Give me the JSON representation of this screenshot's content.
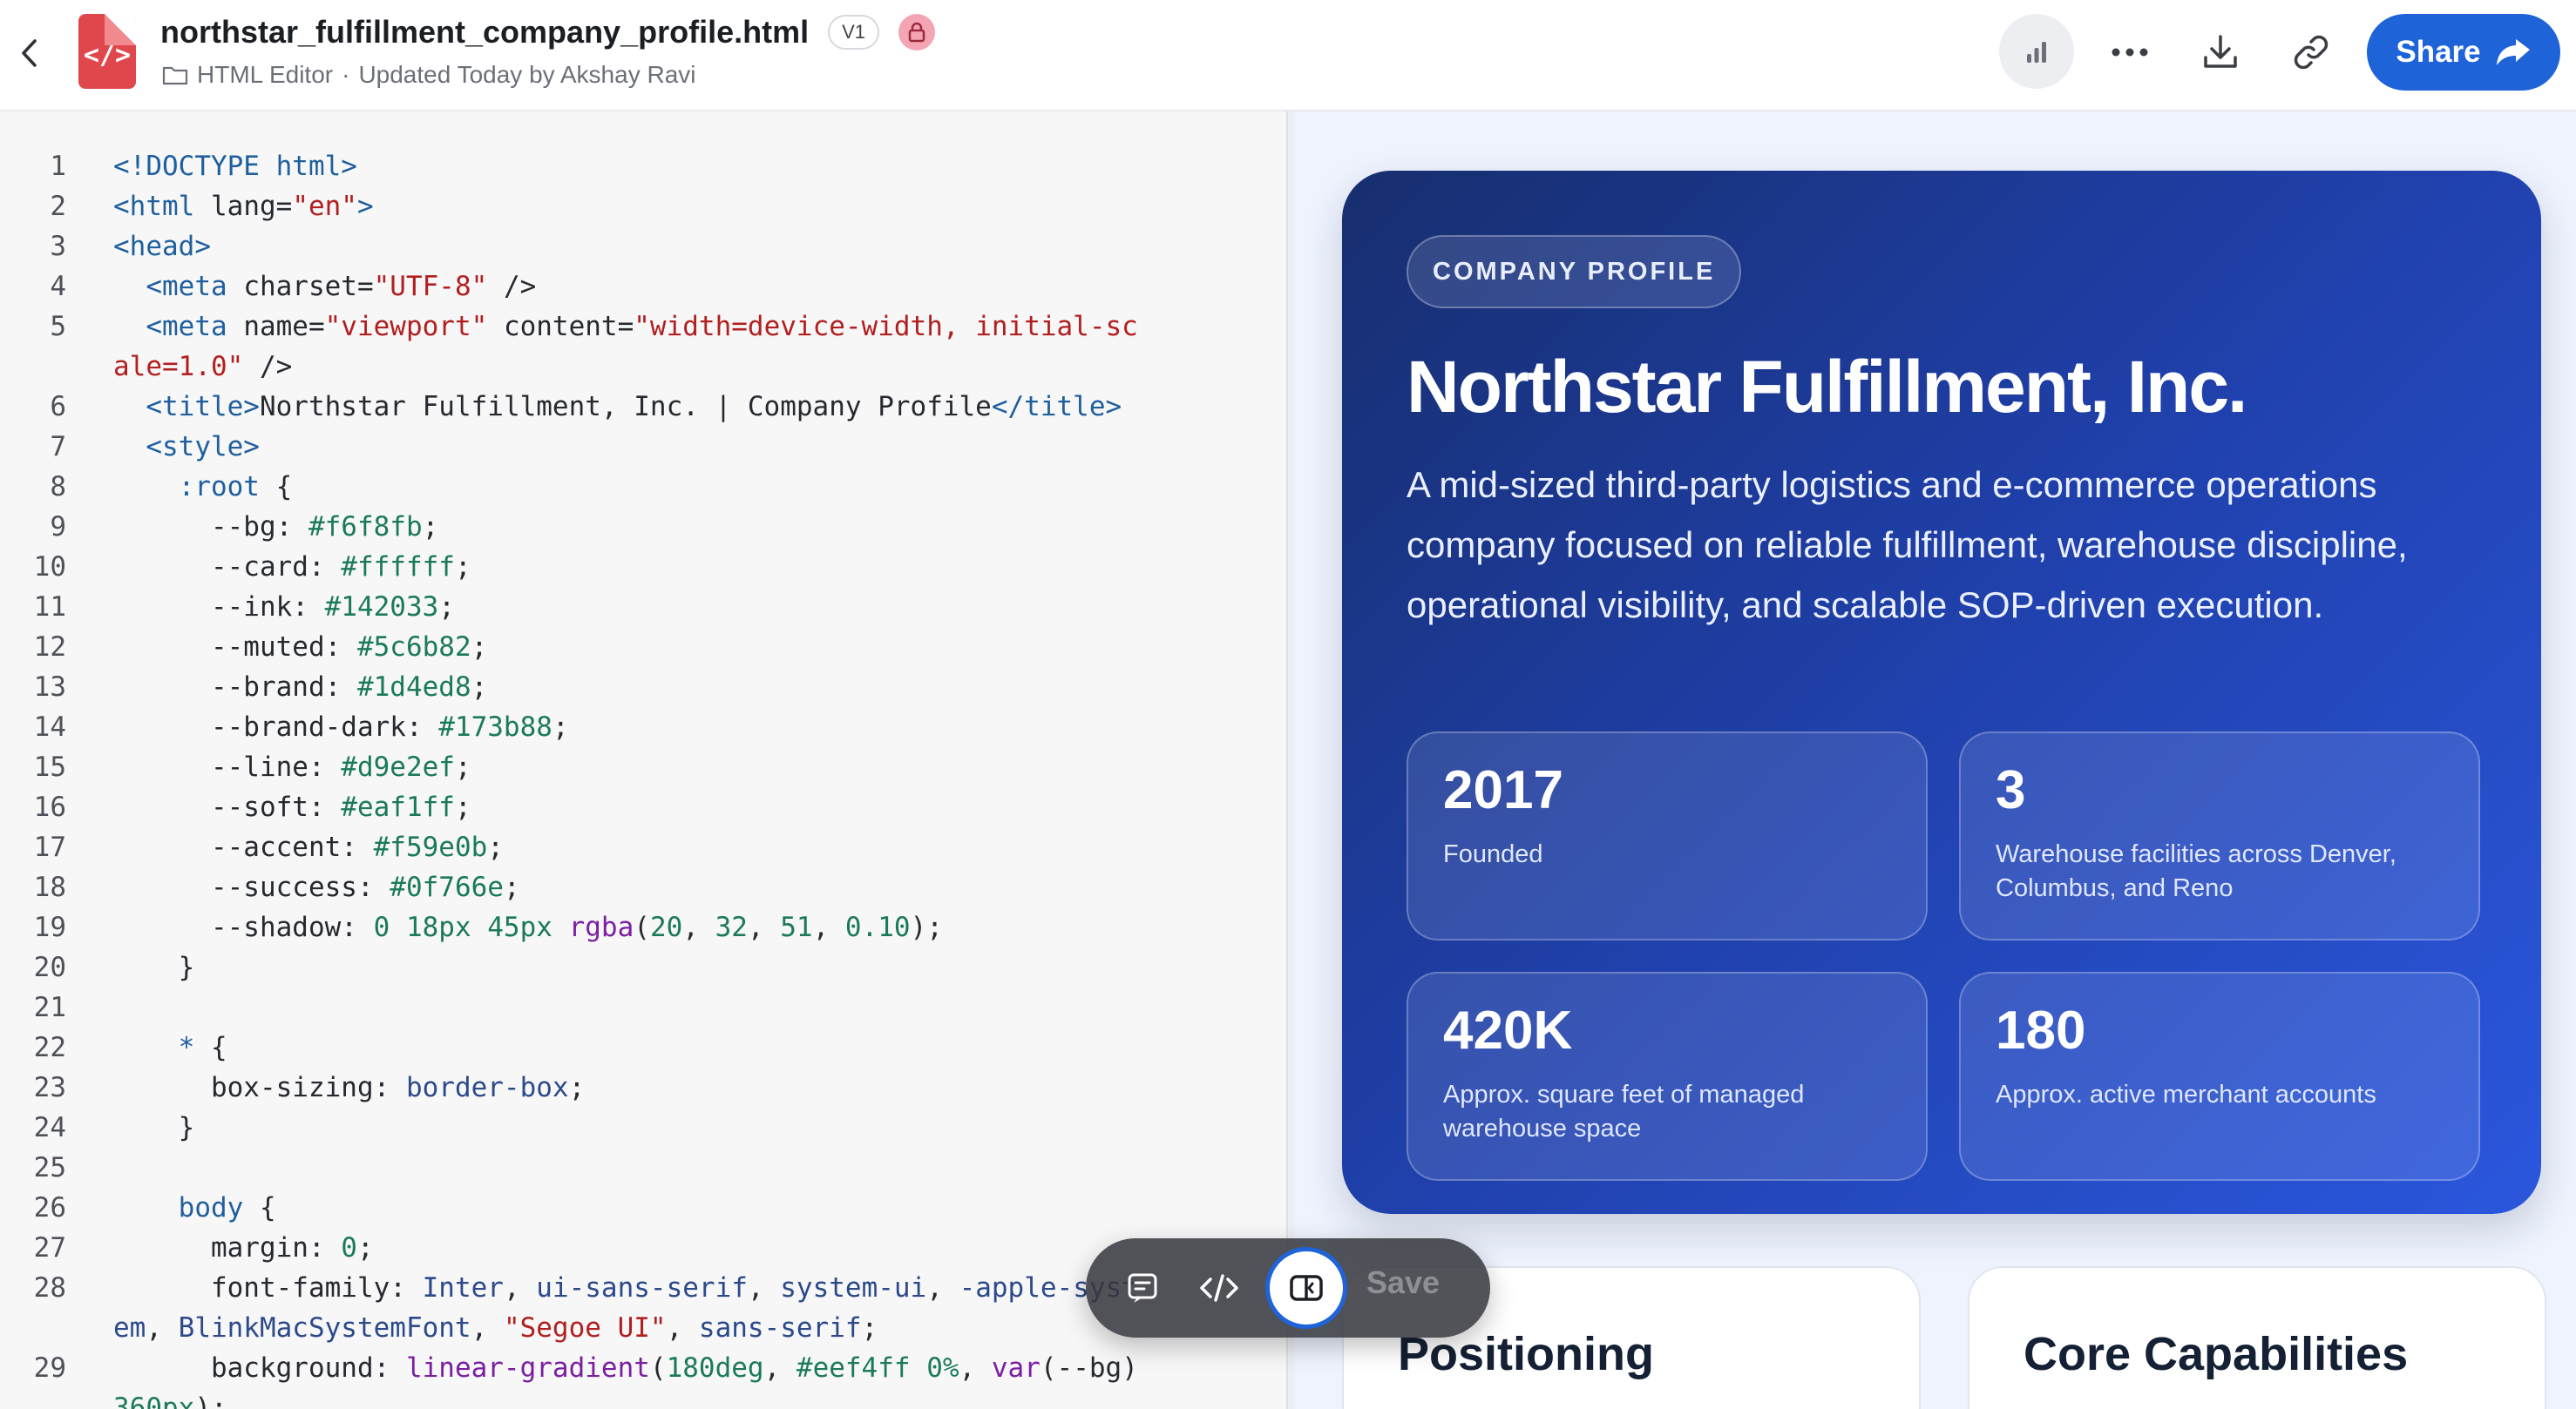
{
  "header": {
    "file_title": "northstar_fulfillment_company_profile.html",
    "version": "V1",
    "location": "HTML Editor",
    "updated": "Updated Today by Akshay Ravi",
    "share_label": "Share",
    "file_icon_glyph": "</>"
  },
  "editor": {
    "lines": [
      {
        "n": "1",
        "html": "<span class='tok-tag'>&lt;!DOCTYPE html&gt;</span>"
      },
      {
        "n": "2",
        "html": "<span class='tok-tag'>&lt;html</span> lang=<span class='tok-str'>\"en\"</span><span class='tok-tag'>&gt;</span>"
      },
      {
        "n": "3",
        "html": "<span class='tok-tag'>&lt;head&gt;</span>"
      },
      {
        "n": "4",
        "html": "  <span class='tok-tag'>&lt;meta</span> charset=<span class='tok-str'>\"UTF-8\"</span> /&gt;"
      },
      {
        "n": "5",
        "html": "  <span class='tok-tag'>&lt;meta</span> name=<span class='tok-str'>\"viewport\"</span> content=<span class='tok-str'>\"width=device-width, initial-scale=1.0\"</span> /&gt;"
      },
      {
        "n": "6",
        "html": "  <span class='tok-tag'>&lt;title&gt;</span>Northstar Fulfillment, Inc. | Company Profile<span class='tok-tag'>&lt;/title&gt;</span>"
      },
      {
        "n": "7",
        "html": "  <span class='tok-tag'>&lt;style&gt;</span>"
      },
      {
        "n": "8",
        "html": "    <span class='tok-sel'>:root</span> {"
      },
      {
        "n": "9",
        "html": "      --bg: <span class='tok-num'>#f6f8fb</span>;"
      },
      {
        "n": "10",
        "html": "      --card: <span class='tok-num'>#ffffff</span>;"
      },
      {
        "n": "11",
        "html": "      --ink: <span class='tok-num'>#142033</span>;"
      },
      {
        "n": "12",
        "html": "      --muted: <span class='tok-num'>#5c6b82</span>;"
      },
      {
        "n": "13",
        "html": "      --brand: <span class='tok-num'>#1d4ed8</span>;"
      },
      {
        "n": "14",
        "html": "      --brand-dark: <span class='tok-num'>#173b88</span>;"
      },
      {
        "n": "15",
        "html": "      --line: <span class='tok-num'>#d9e2ef</span>;"
      },
      {
        "n": "16",
        "html": "      --soft: <span class='tok-num'>#eaf1ff</span>;"
      },
      {
        "n": "17",
        "html": "      --accent: <span class='tok-num'>#f59e0b</span>;"
      },
      {
        "n": "18",
        "html": "      --success: <span class='tok-num'>#0f766e</span>;"
      },
      {
        "n": "19",
        "html": "      --shadow: <span class='tok-num'>0 18px 45px</span> <span class='tok-fn'>rgba</span>(<span class='tok-num'>20</span>, <span class='tok-num'>32</span>, <span class='tok-num'>51</span>, <span class='tok-num'>0.10</span>);"
      },
      {
        "n": "20",
        "html": "    }"
      },
      {
        "n": "21",
        "html": ""
      },
      {
        "n": "22",
        "html": "    <span class='tok-sel'>*</span> {"
      },
      {
        "n": "23",
        "html": "      box-sizing: <span class='tok-kw'>border-box</span>;"
      },
      {
        "n": "24",
        "html": "    }"
      },
      {
        "n": "25",
        "html": ""
      },
      {
        "n": "26",
        "html": "    <span class='tok-sel'>body</span> {"
      },
      {
        "n": "27",
        "html": "      margin: <span class='tok-num'>0</span>;"
      },
      {
        "n": "28",
        "html": "      font-family: <span class='tok-kw'>Inter</span>, <span class='tok-kw'>ui-sans-serif</span>, <span class='tok-kw'>system-ui</span>, <span class='tok-kw'>-apple-system</span>, <span class='tok-kw'>BlinkMacSystemFont</span>, <span class='tok-str'>\"Segoe UI\"</span>, <span class='tok-kw'>sans-serif</span>;"
      },
      {
        "n": "29",
        "html": "      background: <span class='tok-fn'>linear-gradient</span>(<span class='tok-num'>180deg</span>, <span class='tok-num'>#eef4ff 0%</span>, <span class='tok-fn'>var</span>(--bg) <span class='tok-num'>360px</span>);"
      }
    ]
  },
  "preview": {
    "eyebrow": "COMPANY PROFILE",
    "company_name": "Northstar Fulfillment, Inc.",
    "description": "A mid-sized third-party logistics and e-commerce operations company focused on reliable fulfillment, warehouse discipline, operational visibility, and scalable SOP-driven execution.",
    "stats": [
      {
        "value": "2017",
        "label": "Founded"
      },
      {
        "value": "3",
        "label": "Warehouse facilities across Denver, Columbus, and Reno"
      },
      {
        "value": "420K",
        "label": "Approx. square feet of managed warehouse space"
      },
      {
        "value": "180",
        "label": "Approx. active merchant accounts"
      }
    ],
    "sections": [
      {
        "title": "Positioning"
      },
      {
        "title": "Core Capabilities"
      }
    ]
  },
  "toolbar": {
    "save_label": "Save"
  },
  "icons": {
    "back": "chevron-left-icon",
    "file": "html-file-icon",
    "lock": "lock-icon",
    "folder": "folder-icon",
    "stats": "bar-chart-icon",
    "more": "more-horizontal-icon",
    "download": "download-icon",
    "link": "link-icon",
    "share": "share-arrow-icon",
    "comment": "comment-icon",
    "code": "code-icon",
    "split": "split-view-icon"
  },
  "colors": {
    "brand": "#1f63d8",
    "file_icon": "#e0474c",
    "hero_start": "#172e6e",
    "hero_end": "#2b57de",
    "preview_bg": "#eef3fe"
  }
}
